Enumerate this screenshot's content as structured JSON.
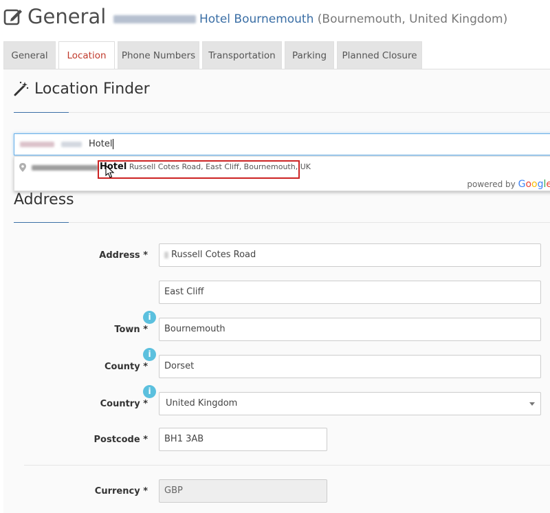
{
  "header": {
    "title": "General",
    "hotel_name": "Hotel Bournemouth",
    "hotel_location": "(Bournemouth, United Kingdom)"
  },
  "tabs": [
    {
      "label": "General"
    },
    {
      "label": "Location"
    },
    {
      "label": "Phone Numbers"
    },
    {
      "label": "Transportation"
    },
    {
      "label": "Parking"
    },
    {
      "label": "Planned Closure"
    }
  ],
  "location_finder": {
    "title": "Location Finder",
    "input_value": "Hotel",
    "suggestion": {
      "match": "Hotel",
      "rest": "Russell Cotes Road, East Cliff, Bournemouth, UK"
    },
    "powered_by": "powered by",
    "google": [
      "G",
      "o",
      "o",
      "g",
      "l",
      "e"
    ]
  },
  "address": {
    "title": "Address",
    "address_label": "Address *",
    "address_line1": "Russell Cotes Road",
    "address_line2": "East Cliff",
    "town_label": "Town *",
    "town": "Bournemouth",
    "county_label": "County *",
    "county": "Dorset",
    "country_label": "Country *",
    "country": "United Kingdom",
    "postcode_label": "Postcode *",
    "postcode": "BH1 3AB",
    "currency_label": "Currency *",
    "currency": "GBP",
    "info_glyph": "i"
  },
  "colors": {
    "accent": "#3a6ea5",
    "active_tab": "#c0392b",
    "highlight_border": "#cc2222",
    "info": "#5bc0de"
  }
}
